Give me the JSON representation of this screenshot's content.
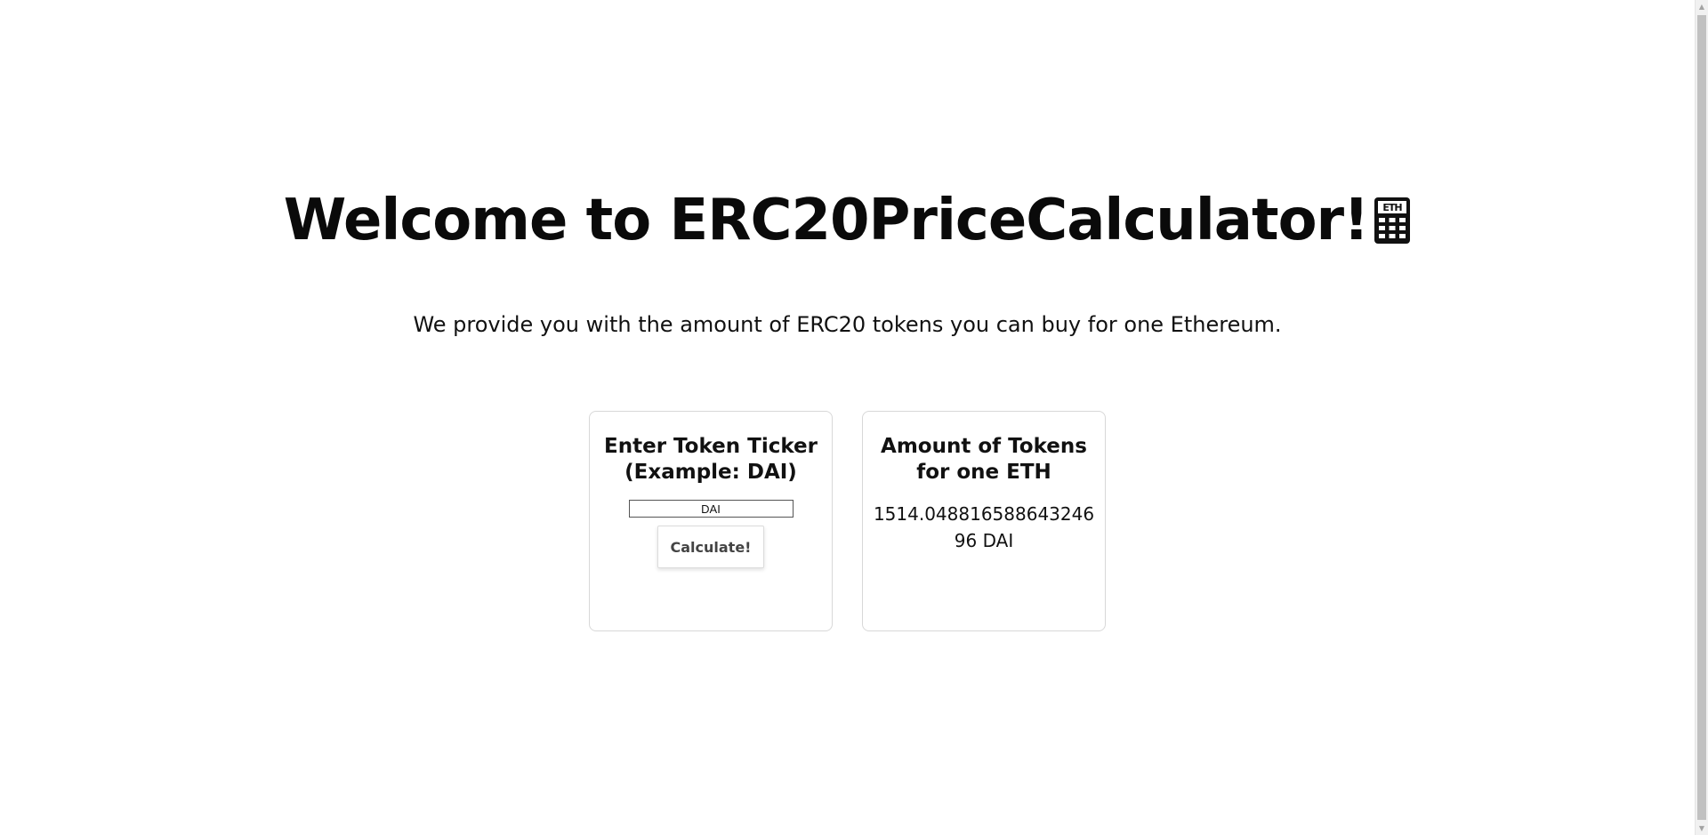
{
  "header": {
    "title": "Welcome to ERC20PriceCalculator!",
    "title_icon": "calculator-icon",
    "subtitle": "We provide you with the amount of ERC20 tokens you can buy for one Ethereum."
  },
  "input_card": {
    "heading": "Enter Token Ticker (Example: DAI)",
    "ticker_value": "DAI",
    "button_label": "Calculate!"
  },
  "result_card": {
    "heading": "Amount of Tokens for one ETH",
    "value": "1514.04881658864324696 DAI"
  },
  "colors": {
    "text": "#111111",
    "card_border": "#d8d8d8",
    "button_text": "#444444"
  }
}
